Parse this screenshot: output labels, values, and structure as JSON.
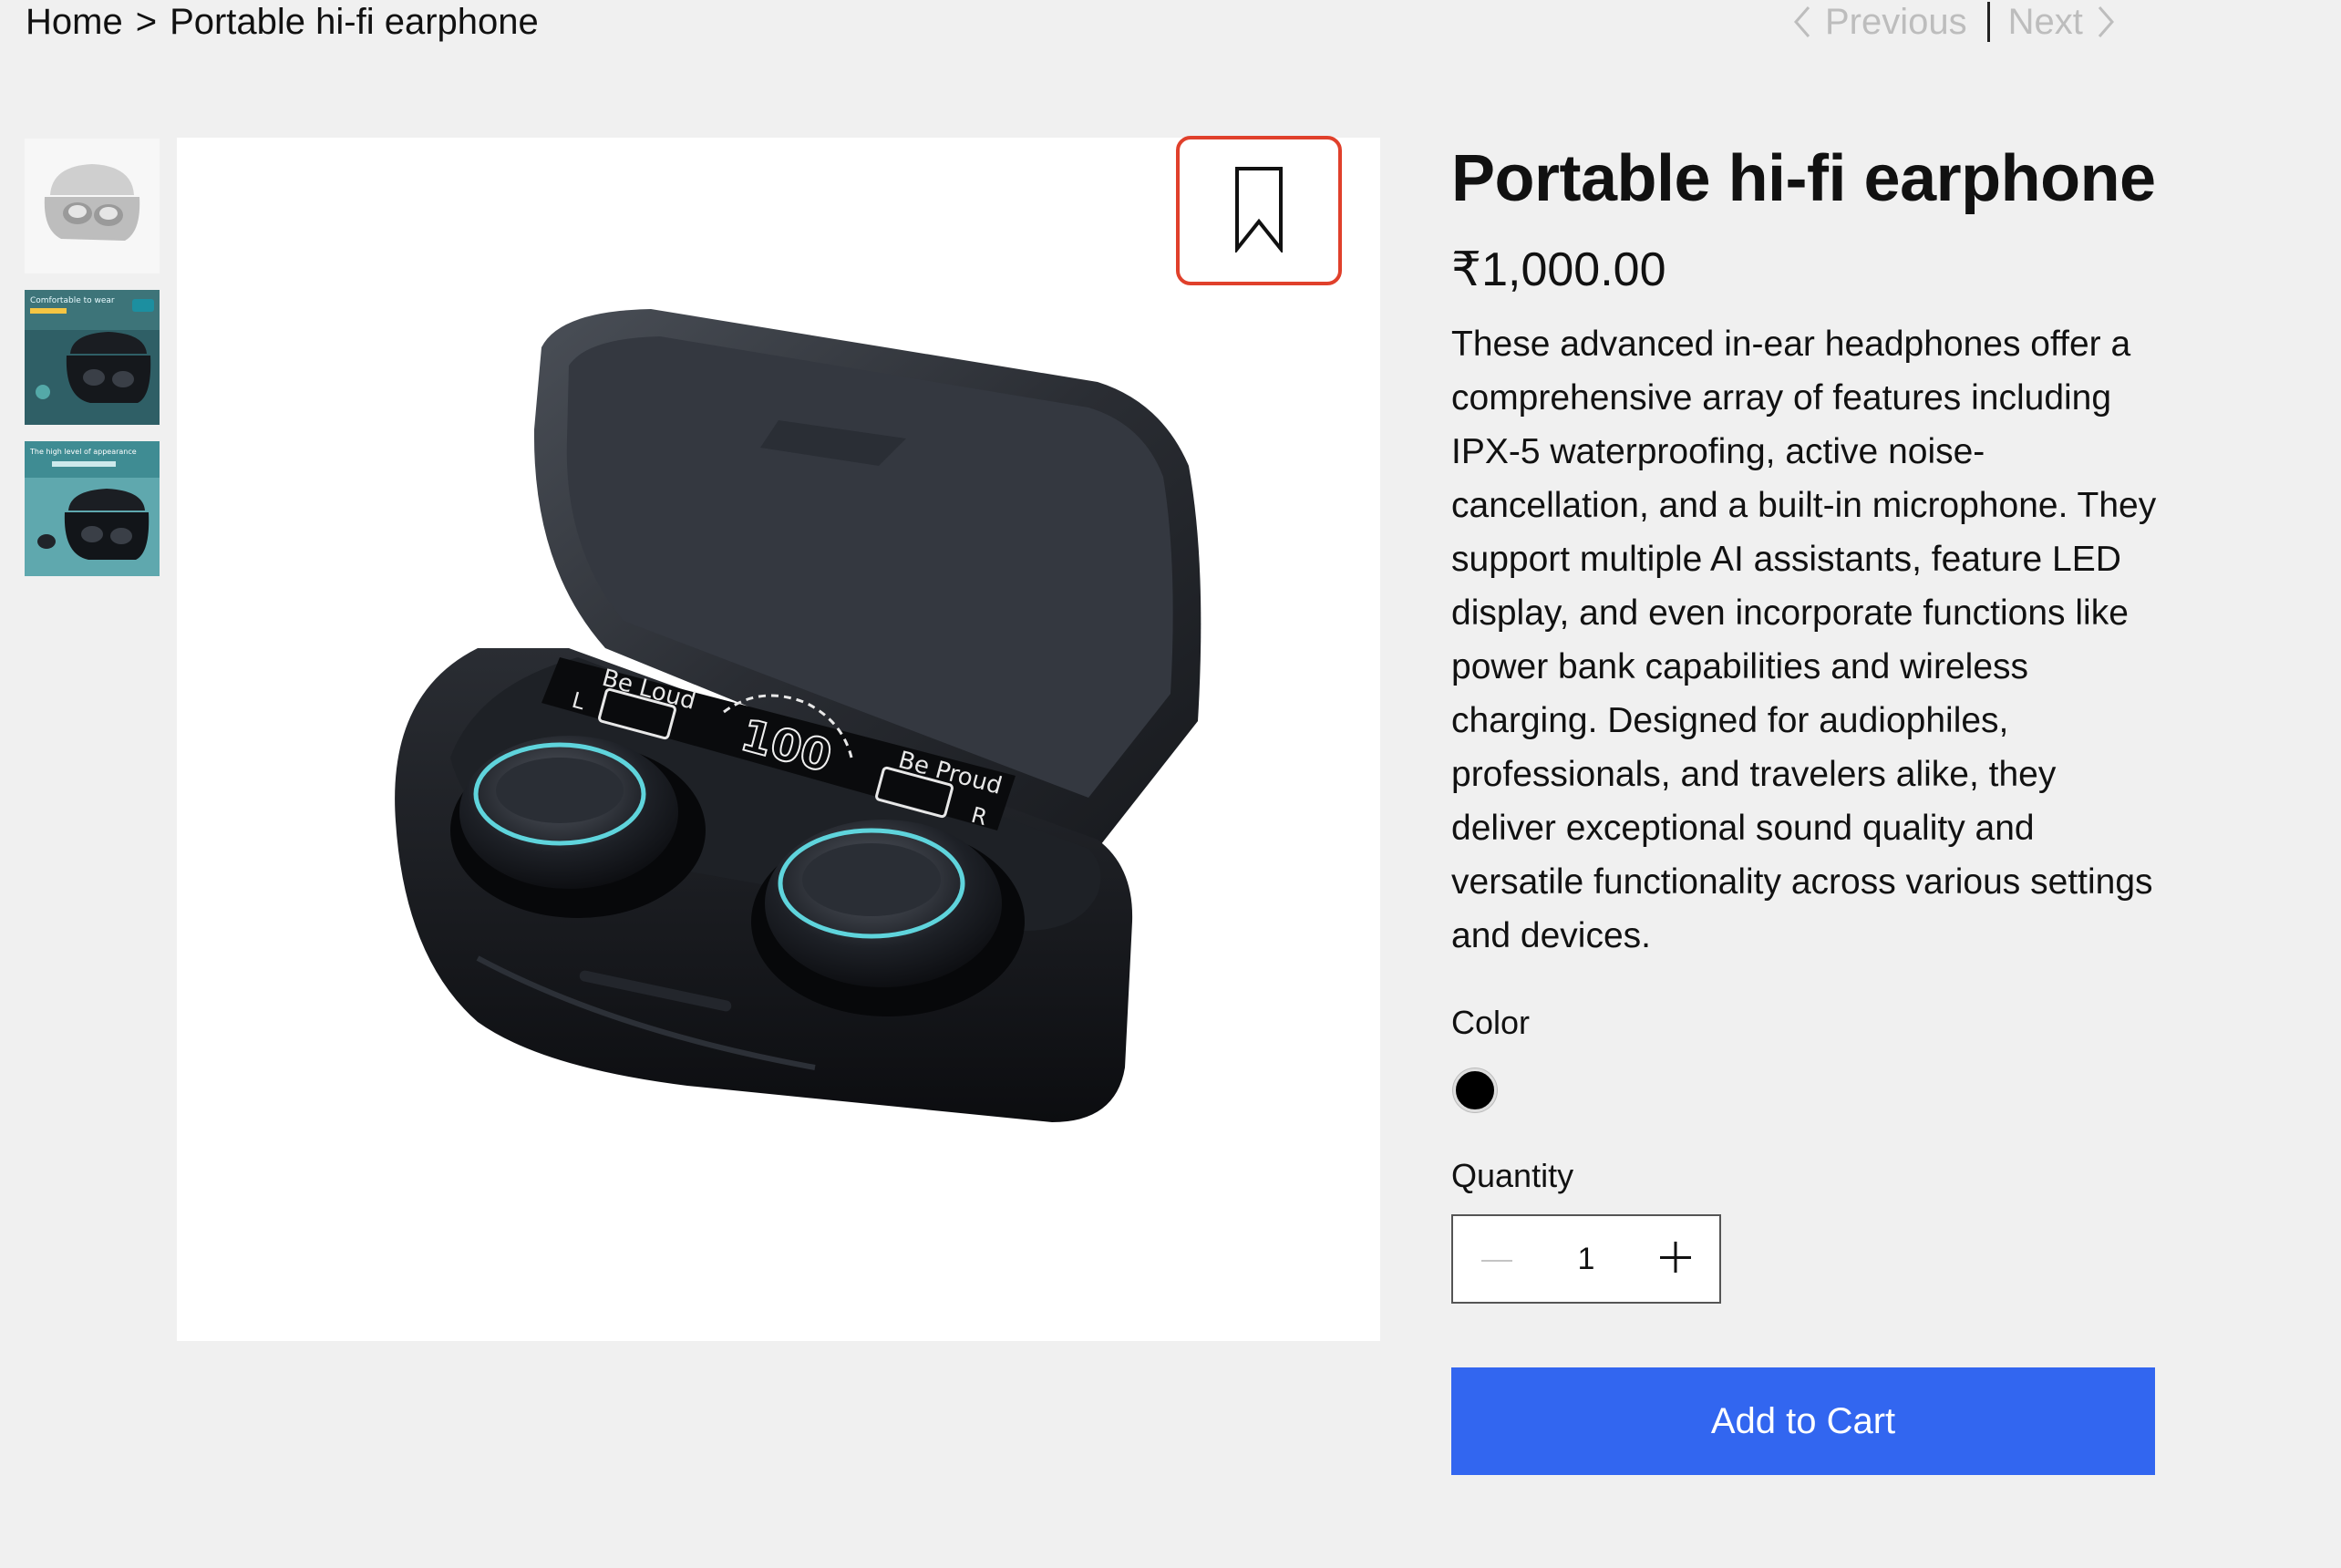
{
  "breadcrumb": {
    "home": "Home",
    "separator": ">",
    "current": "Portable hi-fi earphone"
  },
  "pager": {
    "previous": "Previous",
    "next": "Next",
    "prev_icon": "chevron-left-icon",
    "next_icon": "chevron-right-icon"
  },
  "gallery": {
    "thumbnails": [
      {
        "label": "Earbuds case front view"
      },
      {
        "label": "Comfortable to wear"
      },
      {
        "label": "The high level of appearance"
      }
    ],
    "thumb_captions": {
      "second": "Comfortable to wear",
      "third": "The high level of appearance"
    },
    "case_display": {
      "left_text": "Be Loud",
      "right_text": "Be Proud",
      "percent": "100",
      "left_badge": "L",
      "right_badge": "R"
    },
    "bookmark_icon": "bookmark-icon"
  },
  "product": {
    "title": "Portable hi-fi earphone",
    "price": "₹1,000.00",
    "description": "These advanced in-ear headphones offer a comprehensive array of features including IPX-5 waterproofing, active noise-cancellation, and a built-in microphone. They support multiple AI assistants, feature LED display, and even incorporate functions like power bank capabilities and wireless charging. Designed for audiophiles, professionals, and travelers alike, they deliver exceptional sound quality and versatile functionality across various settings and devices.",
    "color_label": "Color",
    "colors": [
      {
        "name": "Black",
        "hex": "#000000"
      }
    ],
    "quantity_label": "Quantity",
    "quantity": "1",
    "add_to_cart": "Add to Cart"
  },
  "theme": {
    "accent": "#3266f0",
    "bookmark_border": "#e0402b",
    "background": "#f0f0f0"
  }
}
